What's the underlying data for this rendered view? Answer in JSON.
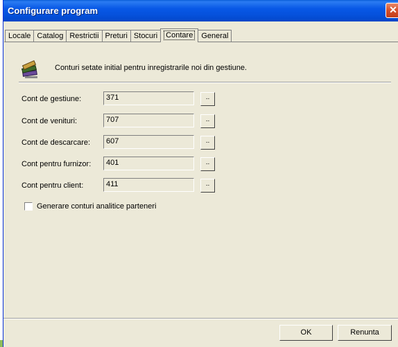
{
  "window": {
    "title": "Configurare program",
    "close_glyph": "✕"
  },
  "tabs": [
    {
      "label": "Locale"
    },
    {
      "label": "Catalog"
    },
    {
      "label": "Restrictii"
    },
    {
      "label": "Preturi"
    },
    {
      "label": "Stocuri"
    },
    {
      "label": "Contare",
      "active": true
    },
    {
      "label": "General"
    }
  ],
  "info": {
    "text": "Conturi setate initial pentru inregistrarile noi din gestiune.",
    "icon": "books-icon"
  },
  "fields": [
    {
      "label": "Cont de gestiune:",
      "value": "371",
      "browse": ".."
    },
    {
      "label": "Cont de venituri:",
      "value": "707",
      "browse": ".."
    },
    {
      "label": "Cont de descarcare:",
      "value": "607",
      "browse": ".."
    },
    {
      "label": "Cont pentru furnizor:",
      "value": "401",
      "browse": ".."
    },
    {
      "label": "Cont pentru client:",
      "value": "411",
      "browse": ".."
    }
  ],
  "checkbox": {
    "label": "Generare conturi analitice parteneri",
    "checked": false
  },
  "buttons": {
    "ok": "OK",
    "cancel": "Renunta"
  }
}
